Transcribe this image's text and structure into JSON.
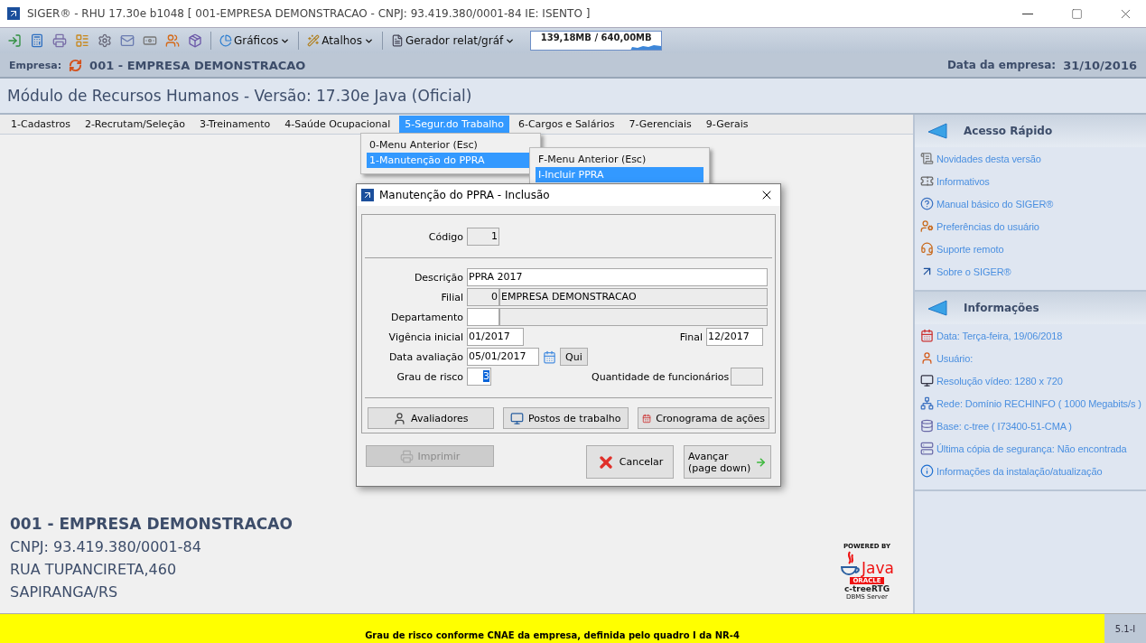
{
  "window": {
    "title": "SIGER® - RHU 17.30e b1048 [ 001-EMPRESA DEMONSTRACAO - CNPJ: 93.419.380/0001-84 IE: ISENTO ]"
  },
  "toolbar": {
    "menus": [
      {
        "label": "Gráficos"
      },
      {
        "label": "Atalhos"
      },
      {
        "label": "Gerador relat/gráf"
      }
    ],
    "memory": "139,18MB / 640,00MB"
  },
  "company_bar": {
    "label": "Empresa:",
    "name": "001 - EMPRESA DEMONSTRACAO",
    "date_label": "Data da empresa:",
    "date": "31/10/2016"
  },
  "module_title": "Módulo de Recursos Humanos - Versão: 17.30e Java (Oficial)",
  "menu": [
    {
      "label": "1-Cadastros",
      "selected": false
    },
    {
      "label": "2-Recrutam/Seleção",
      "selected": false
    },
    {
      "label": "3-Treinamento",
      "selected": false
    },
    {
      "label": "4-Saúde Ocupacional",
      "selected": false
    },
    {
      "label": "5-Segur.do Trabalho",
      "selected": true
    },
    {
      "label": "6-Cargos e Salários",
      "selected": false
    },
    {
      "label": "7-Gerenciais",
      "selected": false
    },
    {
      "label": "9-Gerais",
      "selected": false
    }
  ],
  "dropdown": [
    {
      "label": "0-Menu Anterior (Esc)",
      "selected": false
    },
    {
      "label": "1-Manutenção do PPRA",
      "selected": true
    }
  ],
  "submenu": [
    {
      "label": "F-Menu Anterior (Esc)",
      "selected": false
    },
    {
      "label": "I-Incluir PPRA",
      "selected": true
    }
  ],
  "dialog": {
    "title": "Manutenção do PPRA - Inclusão",
    "codigo": {
      "label": "Código",
      "value": "1",
      "disabled": true
    },
    "descricao": {
      "label": "Descrição",
      "value": "PPRA 2017",
      "disabled": false
    },
    "filial": {
      "label": "Filial",
      "code": "0",
      "name": "EMPRESA DEMONSTRACAO",
      "disabled": true
    },
    "departamento": {
      "label": "Departamento",
      "disabled": false
    },
    "vigencia": {
      "label": "Vigência inicial",
      "value": "01/2017",
      "final_label": "Final",
      "final_value": "12/2017"
    },
    "data_avaliacao": {
      "label": "Data avaliação",
      "value": "05/01/2017",
      "weekday": "Qui"
    },
    "grau_risco": {
      "label": "Grau de risco",
      "value": "3",
      "highlighted": true
    },
    "quantidade": {
      "label": "Quantidade de funcionários",
      "disabled": true
    },
    "sections": [
      {
        "label": "Avaliadores",
        "disabled": false
      },
      {
        "label": "Postos de trabalho",
        "disabled": false
      },
      {
        "label": "Cronograma de ações",
        "disabled": false
      }
    ],
    "print": {
      "label": "Imprimir",
      "disabled": true
    },
    "cancel": {
      "label": "Cancelar",
      "disabled": false
    },
    "next": {
      "lines": [
        "Avançar",
        "(page down)"
      ],
      "disabled": false
    }
  },
  "company_info": {
    "name": "001 - EMPRESA DEMONSTRACAO",
    "lines": [
      "CNPJ: 93.419.380/0001-84",
      "RUA TUPANCIRETA,460",
      "SAPIRANGA/RS"
    ]
  },
  "logo": {
    "powered": "POWERED BY",
    "java": "Java",
    "oracle": "ORACLE",
    "ctree": "c-treeRTG",
    "server": "DBMS Server"
  },
  "sidebar": [
    {
      "title": "Acesso Rápido",
      "items": [
        "Novidades desta versão",
        "Informativos",
        "Manual básico do SIGER®",
        "Preferências do usuário",
        "Suporte remoto",
        "Sobre o SIGER®"
      ]
    },
    {
      "title": "Informações",
      "items": [
        "Data: Terça-feira, 19/06/2018",
        "Usuário:",
        "Resolução vídeo:  1280 x 720",
        "Rede: Domínio RECHINFO ( 1000 Megabits/s )",
        "Base: c-tree ( I73400-51-CMA )",
        "Última cópia de segurança: Não encontrada",
        "Informações da instalação/atualização"
      ]
    }
  ],
  "status_bar": {
    "message": "Grau de risco conforme CNAE da empresa, definida pelo quadro I da NR-4",
    "code": "5.1-I"
  }
}
